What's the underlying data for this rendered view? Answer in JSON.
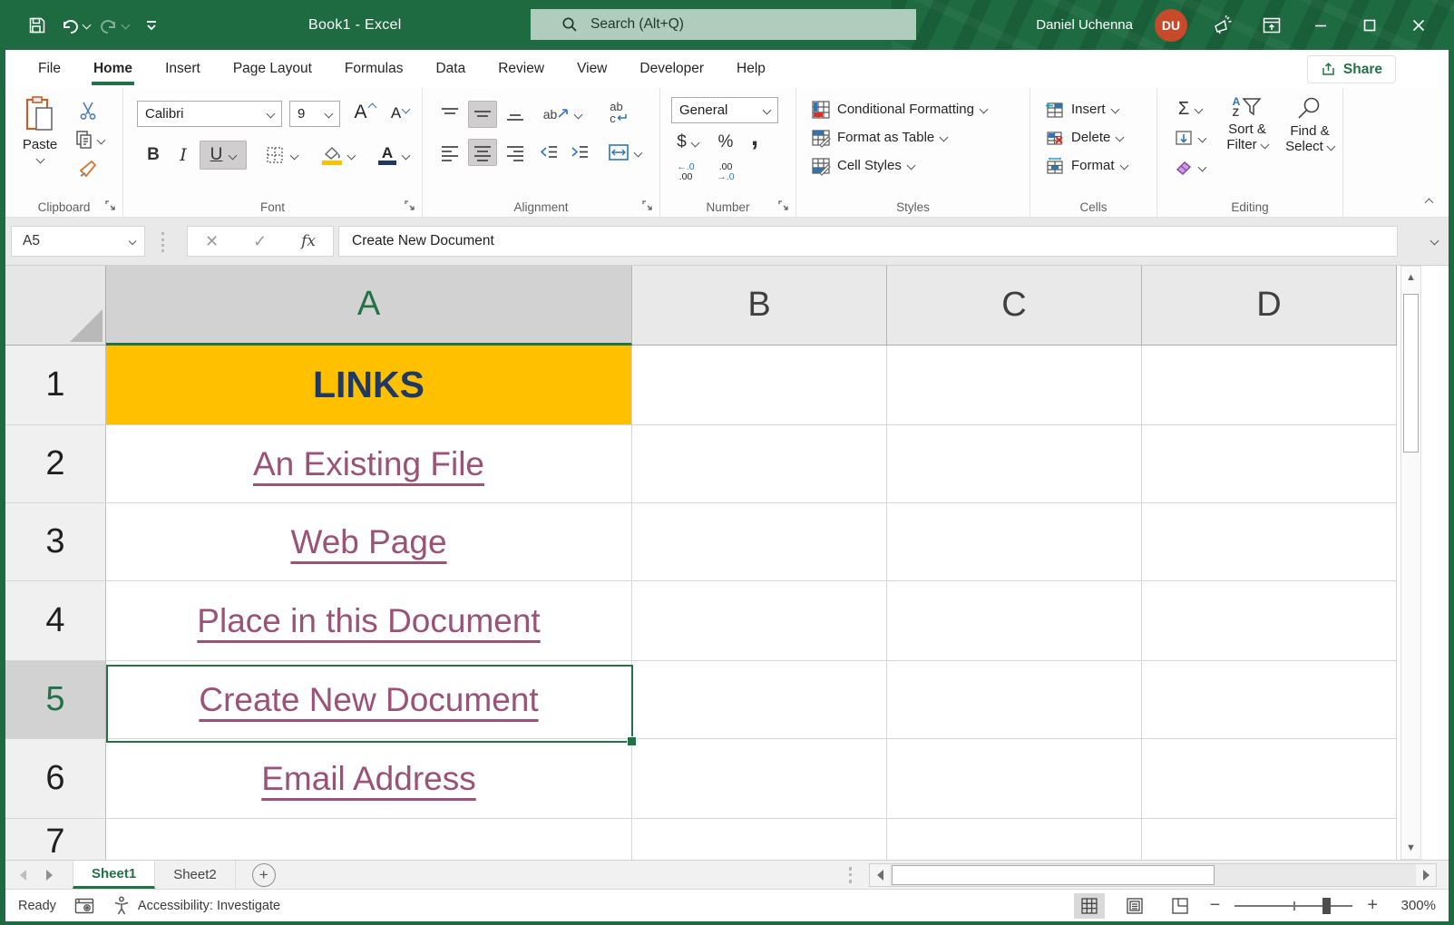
{
  "titlebar": {
    "title": "Book1  -  Excel",
    "search_placeholder": "Search (Alt+Q)",
    "user_name": "Daniel Uchenna",
    "user_initials": "DU"
  },
  "colors": {
    "accent_green": "#217346",
    "titlebar_green": "#1E6B41",
    "link_purple": "#9A5277",
    "cell_fill_yellow": "#FFC000",
    "cell_font_navy": "#1F3864",
    "avatar_orange": "#C74A2B"
  },
  "ribbon_tabs": [
    {
      "label": "File"
    },
    {
      "label": "Home"
    },
    {
      "label": "Insert"
    },
    {
      "label": "Page Layout"
    },
    {
      "label": "Formulas"
    },
    {
      "label": "Data"
    },
    {
      "label": "Review"
    },
    {
      "label": "View"
    },
    {
      "label": "Developer"
    },
    {
      "label": "Help"
    }
  ],
  "active_tab": "Home",
  "share_label": "Share",
  "ribbon": {
    "clipboard": {
      "label": "Clipboard",
      "paste": "Paste"
    },
    "font": {
      "label": "Font",
      "font_name": "Calibri",
      "font_size": "9",
      "bold": "B",
      "italic": "I",
      "underline": "U",
      "grow": "A",
      "shrink": "A"
    },
    "alignment": {
      "label": "Alignment",
      "orientation_text": "ab",
      "wrap_top": "ab",
      "wrap_bottom": "c"
    },
    "number": {
      "label": "Number",
      "format": "General",
      "currency": "$",
      "percent": "%",
      "comma": ",",
      "inc_dec_top": "←.0",
      "inc_dec_bottom": ".00",
      "dec_dec_top": ".00",
      "dec_dec_bottom": "→.0"
    },
    "styles": {
      "label": "Styles",
      "items": [
        {
          "label": "Conditional Formatting"
        },
        {
          "label": "Format as Table"
        },
        {
          "label": "Cell Styles"
        }
      ]
    },
    "cells": {
      "label": "Cells",
      "items": [
        {
          "label": "Insert"
        },
        {
          "label": "Delete"
        },
        {
          "label": "Format"
        }
      ]
    },
    "editing": {
      "label": "Editing",
      "autosum": "Σ",
      "az_a": "A",
      "az_z": "Z",
      "sort_line1": "Sort &",
      "sort_line2": "Filter",
      "find_line1": "Find &",
      "find_line2": "Select"
    }
  },
  "formula_bar": {
    "name_box": "A5",
    "fx_label": "fx",
    "value": "Create New Document"
  },
  "grid": {
    "columns": [
      {
        "label": "A"
      },
      {
        "label": "B"
      },
      {
        "label": "C"
      },
      {
        "label": "D"
      }
    ],
    "selected_column": "A",
    "selected_cell": "A5",
    "rows": [
      {
        "num": "1",
        "value": "LINKS"
      },
      {
        "num": "2",
        "value": "An Existing File"
      },
      {
        "num": "3",
        "value": "Web Page"
      },
      {
        "num": "4",
        "value": "Place in this Document"
      },
      {
        "num": "5",
        "value": "Create New Document"
      },
      {
        "num": "6",
        "value": "Email Address"
      },
      {
        "num": "7",
        "value": ""
      }
    ]
  },
  "sheet_tabs": {
    "tabs": [
      {
        "label": "Sheet1"
      },
      {
        "label": "Sheet2"
      }
    ],
    "active": "Sheet1"
  },
  "status_bar": {
    "mode": "Ready",
    "accessibility": "Accessibility: Investigate",
    "zoom": "300%"
  }
}
